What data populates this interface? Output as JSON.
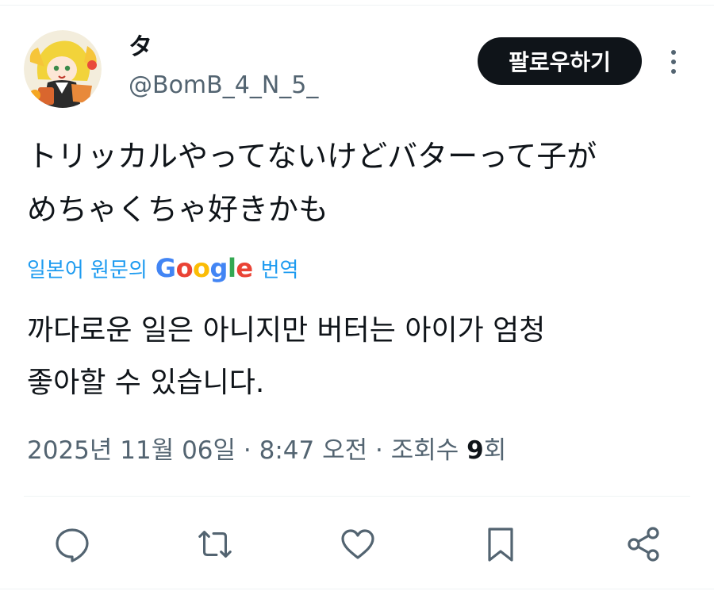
{
  "user": {
    "display_name": "タ",
    "handle": "@BomB_4_N_5_",
    "follow_label": "팔로우하기"
  },
  "tweet": {
    "text_lines": [
      "トリッカルやってないけどバターって子が",
      "めちゃくちゃ好きかも"
    ]
  },
  "translation": {
    "label": "일본어 원문의",
    "provider": "Google",
    "action": "번역",
    "text_lines": [
      "까다로운 일은 아니지만 버터는 아이가 엄청",
      "좋아할 수 있습니다."
    ]
  },
  "meta": {
    "date": "2025년 11월 06일",
    "time": "8:47 오전",
    "views_label": "조회수",
    "views_count": "9",
    "views_suffix": "회",
    "separator": "·"
  },
  "actions": [
    "reply-icon",
    "retweet-icon",
    "like-icon",
    "bookmark-icon",
    "share-icon"
  ],
  "colors": {
    "accent": "#1d9bf0",
    "text": "#0f1419",
    "secondary": "#536471",
    "button_bg": "#0f1419"
  }
}
